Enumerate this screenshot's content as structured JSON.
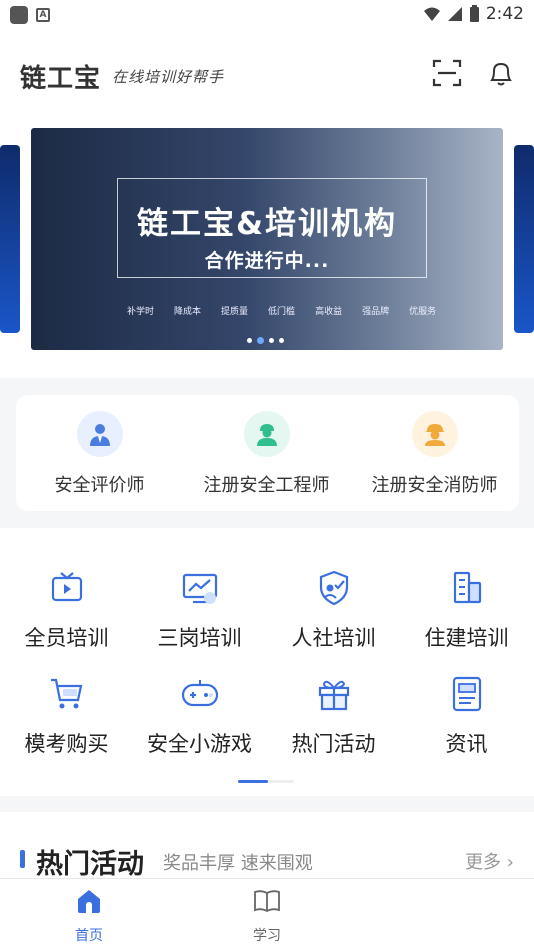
{
  "status_bar": {
    "time": "2:42",
    "a_label": "A"
  },
  "header": {
    "logo": "链工宝",
    "slogan": "在线培训好帮手",
    "scan_icon": "scan-icon",
    "bell_icon": "bell-icon"
  },
  "banner": {
    "title": "链工宝&培训机构",
    "subtitle": "合作进行中...",
    "tags": [
      "补学时",
      "降成本",
      "提质量",
      "低门槛",
      "高收益",
      "强品牌",
      "优服务"
    ],
    "slide_count": 4,
    "active_slide": 2
  },
  "certs": [
    {
      "label": "安全评价师",
      "icon": "evaluator-icon",
      "bg": "#e8f0ff",
      "color": "#4a7de0"
    },
    {
      "label": "注册安全工程师",
      "icon": "engineer-icon",
      "bg": "#e4f7f1",
      "color": "#2fbf8f"
    },
    {
      "label": "注册安全消防师",
      "icon": "firefighter-icon",
      "bg": "#fff3e0",
      "color": "#f2a93b"
    }
  ],
  "grid": [
    {
      "label": "全员培训",
      "icon": "tv-icon"
    },
    {
      "label": "三岗培训",
      "icon": "monitor-chart-icon"
    },
    {
      "label": "人社培训",
      "icon": "shield-user-icon"
    },
    {
      "label": "住建培训",
      "icon": "building-icon"
    },
    {
      "label": "模考购买",
      "icon": "cart-icon"
    },
    {
      "label": "安全小游戏",
      "icon": "gamepad-icon"
    },
    {
      "label": "热门活动",
      "icon": "gift-icon"
    },
    {
      "label": "资讯",
      "icon": "news-icon"
    }
  ],
  "hot_section": {
    "title": "热门活动",
    "subtitle": "奖品丰厚 速来围观",
    "more": "更多"
  },
  "tabs": [
    {
      "label": "首页",
      "icon": "home-icon",
      "active": true
    },
    {
      "label": "学习",
      "icon": "book-icon",
      "active": false
    }
  ],
  "colors": {
    "accent": "#3b6fe0",
    "icon_blue": "#4a7de0",
    "inactive": "#666666"
  }
}
